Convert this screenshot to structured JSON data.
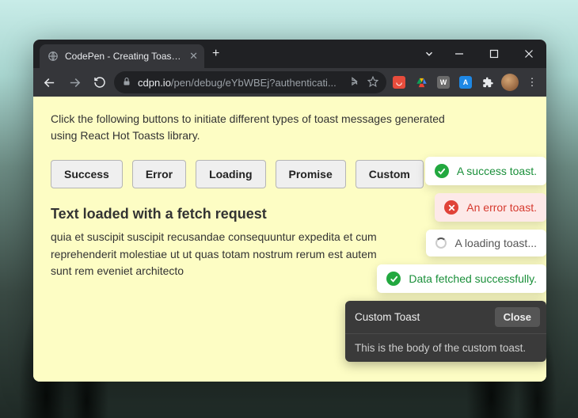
{
  "browser": {
    "tab_title": "CodePen - Creating Toast Notifs",
    "url_host": "cdpn.io",
    "url_path": "/pen/debug/eYbWBEj?authenticati...",
    "ext_icons": [
      "pocket",
      "drive",
      "w",
      "a",
      "puzzle"
    ]
  },
  "page": {
    "intro": "Click the following buttons to initiate different types of toast messages generated using React Hot Toasts library.",
    "buttons": [
      "Success",
      "Error",
      "Loading",
      "Promise",
      "Custom"
    ],
    "fetch_title": "Text loaded with a fetch request",
    "fetch_body": "quia et suscipit suscipit recusandae consequuntur expedita et cum reprehenderit molestiae ut ut quas totam nostrum rerum est autem sunt rem eveniet architecto"
  },
  "toasts": {
    "success": "A success toast.",
    "error": "An error toast.",
    "loading": "A loading toast...",
    "fetched": "Data fetched successfully.",
    "custom_title": "Custom Toast",
    "custom_close": "Close",
    "custom_body": "This is the body of the custom toast."
  }
}
